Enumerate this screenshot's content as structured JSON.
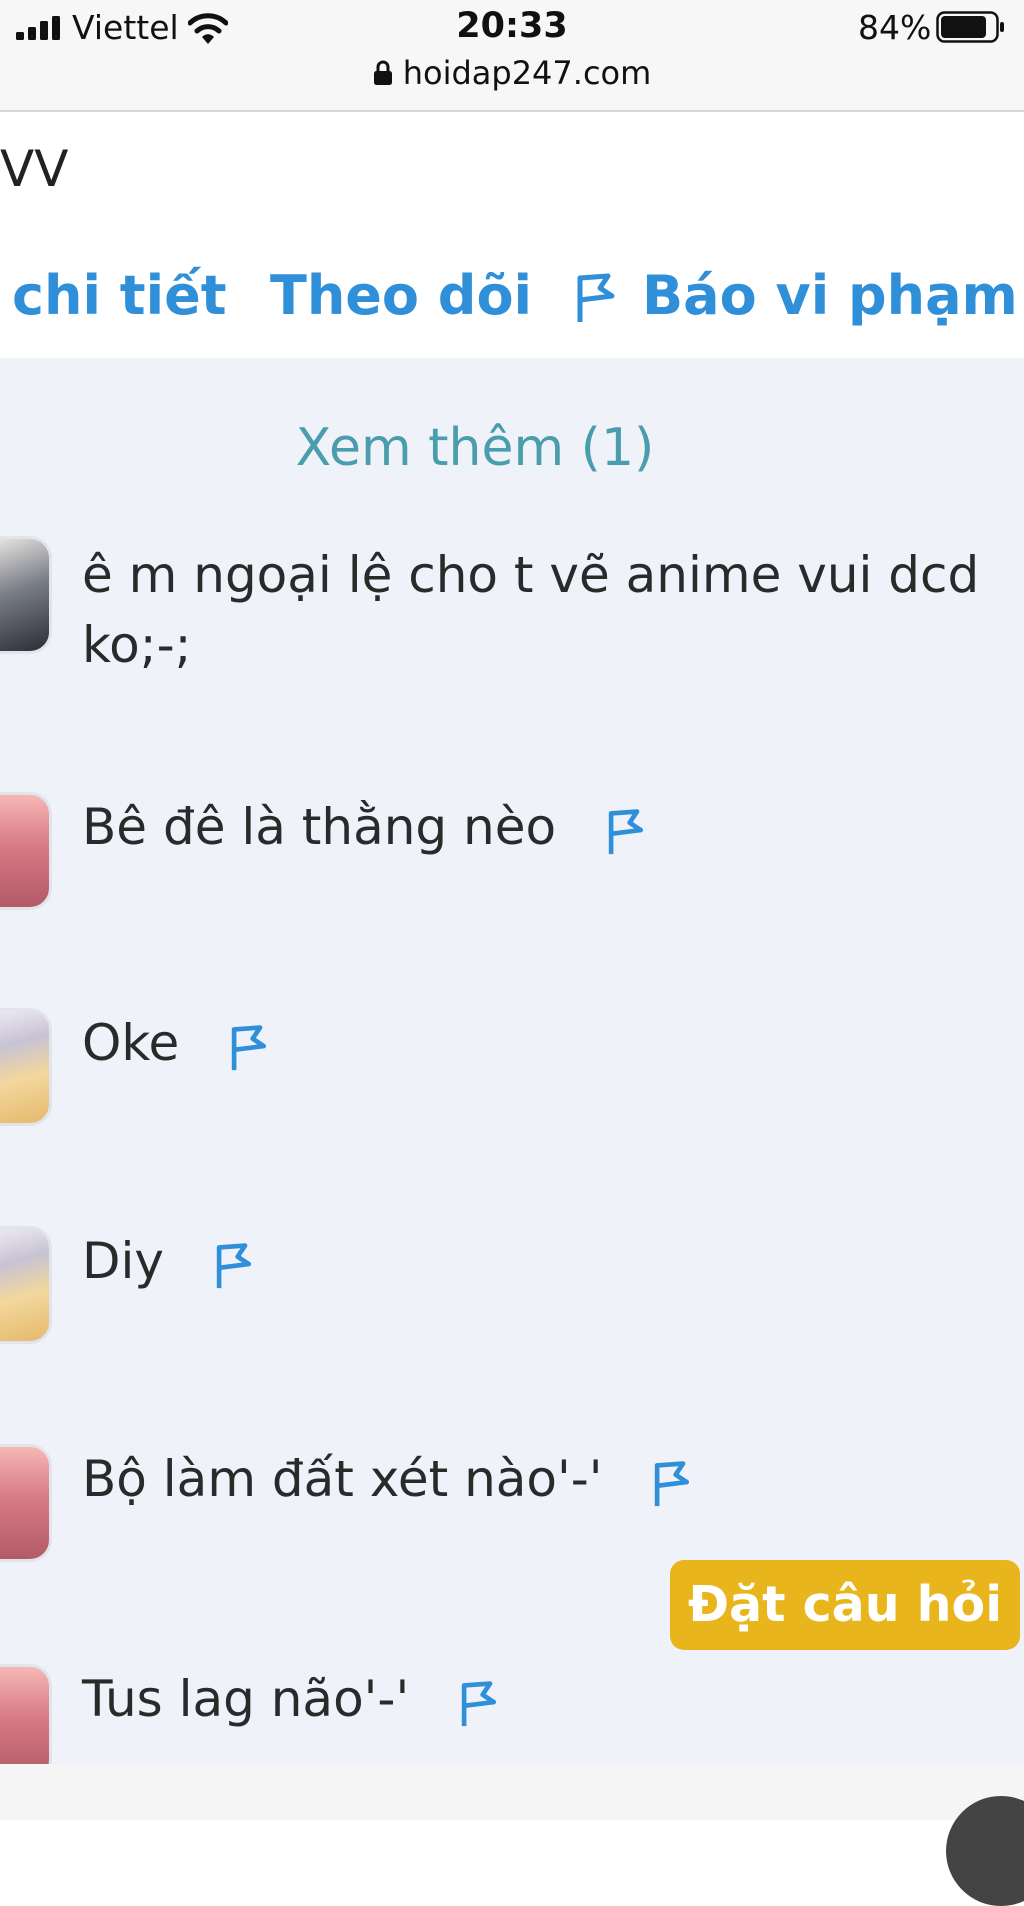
{
  "status_bar": {
    "carrier": "Viettel",
    "time": "20:33",
    "battery": "84%",
    "battery_level": 0.84,
    "url": "hoidap247.com"
  },
  "question": {
    "text_fragment": "VV",
    "actions": {
      "detail": "chi tiết",
      "follow": "Theo dõi",
      "report": "Báo vi phạm"
    }
  },
  "comments": {
    "see_more": "Xem thêm (1)",
    "items": [
      {
        "text": "ê m ngoại lệ cho t vẽ anime vui dcd ko;-;"
      },
      {
        "text": "Bê đê là thằng nèo"
      },
      {
        "text": "Oke"
      },
      {
        "text": "Diy"
      },
      {
        "text": "Bộ làm đất xét nào'-'"
      },
      {
        "text": "Tus lag não'-'"
      }
    ]
  },
  "ask_button": "Đặt câu hỏi",
  "colors": {
    "link_blue": "#2f8fd8",
    "see_more_teal": "#4a9dac",
    "ask_yellow": "#e8b61c",
    "comment_bg": "#eff2f8"
  }
}
